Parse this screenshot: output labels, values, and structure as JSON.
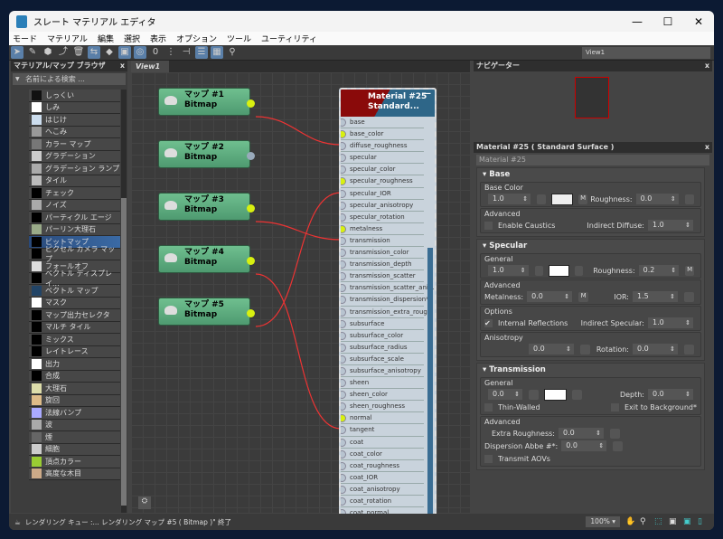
{
  "window": {
    "title": "スレート マテリアル エディタ",
    "min": "—",
    "max": "☐",
    "close": "✕"
  },
  "menu": [
    "モード",
    "マテリアル",
    "編集",
    "選択",
    "表示",
    "オプション",
    "ツール",
    "ユーティリティ"
  ],
  "view_select": "View1",
  "browser": {
    "title": "マテリアル/マップ ブラウザ",
    "close": "x",
    "search_placeholder": "名前による検索 ...",
    "items": [
      {
        "label": "しっくい",
        "color": "#111"
      },
      {
        "label": "しみ",
        "color": "#fff"
      },
      {
        "label": "はじけ",
        "color": "#cde"
      },
      {
        "label": "へこみ",
        "color": "#999"
      },
      {
        "label": "カラー マップ",
        "color": "#777"
      },
      {
        "label": "グラデーション",
        "color": "#ccc"
      },
      {
        "label": "グラデーション ランプ",
        "color": "#aaa"
      },
      {
        "label": "タイル",
        "color": "#bbb"
      },
      {
        "label": "チェック",
        "color": "#000"
      },
      {
        "label": "ノイズ",
        "color": "#aaa"
      },
      {
        "label": "パーティクル エージ",
        "color": "#000"
      },
      {
        "label": "パーリン大理石",
        "color": "#9a8"
      },
      {
        "label": "ビットマップ",
        "color": "#000",
        "selected": true
      },
      {
        "label": "ピクセル カメラ マップ",
        "color": "#000"
      },
      {
        "label": "フォールオフ",
        "color": "#ddd"
      },
      {
        "label": "ベクトル ディスプレイ...",
        "color": "#000"
      },
      {
        "label": "ベクトル マップ",
        "color": "#246"
      },
      {
        "label": "マスク",
        "color": "#fff"
      },
      {
        "label": "マップ出力セレクタ",
        "color": "#000"
      },
      {
        "label": "マルチ タイル",
        "color": "#000"
      },
      {
        "label": "ミックス",
        "color": "#000"
      },
      {
        "label": "レイトレース",
        "color": "#000"
      },
      {
        "label": "出力",
        "color": "#fff"
      },
      {
        "label": "合成",
        "color": "#000"
      },
      {
        "label": "大理石",
        "color": "#dda"
      },
      {
        "label": "旋回",
        "color": "#db8"
      },
      {
        "label": "法線バンプ",
        "color": "#aaf"
      },
      {
        "label": "波",
        "color": "#aaa"
      },
      {
        "label": "煙",
        "color": "#666"
      },
      {
        "label": "細胞",
        "color": "#ccc"
      },
      {
        "label": "頂点カラー",
        "color": "#9c3"
      },
      {
        "label": "高度な木目",
        "color": "#ca8"
      }
    ]
  },
  "view": {
    "tab": "View1",
    "maps": [
      {
        "name": "マップ #1",
        "type": "Bitmap",
        "connected": true
      },
      {
        "name": "マップ #2",
        "type": "Bitmap",
        "connected": false
      },
      {
        "name": "マップ #3",
        "type": "Bitmap",
        "connected": true
      },
      {
        "name": "マップ #4",
        "type": "Bitmap",
        "connected": true
      },
      {
        "name": "マップ #5",
        "type": "Bitmap",
        "connected": true
      }
    ],
    "material": {
      "name": "Material #25",
      "type": "Standard...",
      "collapse": "—",
      "slots": [
        {
          "n": "base"
        },
        {
          "n": "base_color",
          "on": true
        },
        {
          "n": "diffuse_roughness"
        },
        {
          "n": "specular"
        },
        {
          "n": "specular_color"
        },
        {
          "n": "specular_roughness",
          "on": true
        },
        {
          "n": "specular_IOR"
        },
        {
          "n": "specular_anisotropy"
        },
        {
          "n": "specular_rotation"
        },
        {
          "n": "metalness",
          "on": true
        },
        {
          "n": "transmission"
        },
        {
          "n": "transmission_color"
        },
        {
          "n": "transmission_depth"
        },
        {
          "n": "transmission_scatter"
        },
        {
          "n": "transmission_scatter_ani..."
        },
        {
          "n": "transmission_dispersion*"
        },
        {
          "n": "transmission_extra_roug..."
        },
        {
          "n": "subsurface"
        },
        {
          "n": "subsurface_color"
        },
        {
          "n": "subsurface_radius"
        },
        {
          "n": "subsurface_scale"
        },
        {
          "n": "subsurface_anisotropy"
        },
        {
          "n": "sheen"
        },
        {
          "n": "sheen_color"
        },
        {
          "n": "sheen_roughness"
        },
        {
          "n": "normal",
          "on": true
        },
        {
          "n": "tangent"
        },
        {
          "n": "coat"
        },
        {
          "n": "coat_color"
        },
        {
          "n": "coat_roughness"
        },
        {
          "n": "coat_IOR"
        },
        {
          "n": "coat_anisotropy"
        },
        {
          "n": "coat_rotation"
        },
        {
          "n": "coat_normal"
        }
      ]
    }
  },
  "navigator": {
    "title": "ナビゲーター",
    "close": "x"
  },
  "params": {
    "title": "Material #25  ( Standard Surface )",
    "close": "x",
    "name_field": "Material #25",
    "base": {
      "title": "Base",
      "group": "Base Color",
      "weight": "1.0",
      "m": "M",
      "roughness_label": "Roughness:",
      "roughness": "0.0",
      "adv": "Advanced",
      "caustics": "Enable Caustics",
      "indirect_label": "Indirect Diffuse:",
      "indirect": "1.0"
    },
    "specular": {
      "title": "Specular",
      "general": "General",
      "weight": "1.0",
      "roughness_label": "Roughness:",
      "roughness": "0.2",
      "m": "M",
      "adv": "Advanced",
      "metal_label": "Metalness:",
      "metal": "0.0",
      "ior_label": "IOR:",
      "ior": "1.5",
      "options": "Options",
      "internal": "Internal Reflections",
      "ind_spec_label": "Indirect Specular:",
      "ind_spec": "1.0",
      "aniso": "Anisotropy",
      "aniso_val": "0.0",
      "rot_label": "Rotation:",
      "rot": "0.0"
    },
    "transmission": {
      "title": "Transmission",
      "general": "General",
      "weight": "0.0",
      "depth_label": "Depth:",
      "depth": "0.0",
      "thin": "Thin-Walled",
      "exit": "Exit to Background*",
      "adv": "Advanced",
      "extra_label": "Extra Roughness:",
      "extra": "0.0",
      "disp_label": "Dispersion Abbe #*:",
      "disp": "0.0",
      "aovs": "Transmit AOVs"
    }
  },
  "status": {
    "text": "レンダリング キュー :... レンダリング マップ #5 ( Bitmap )\" 終了",
    "zoom": "100% ▾"
  }
}
